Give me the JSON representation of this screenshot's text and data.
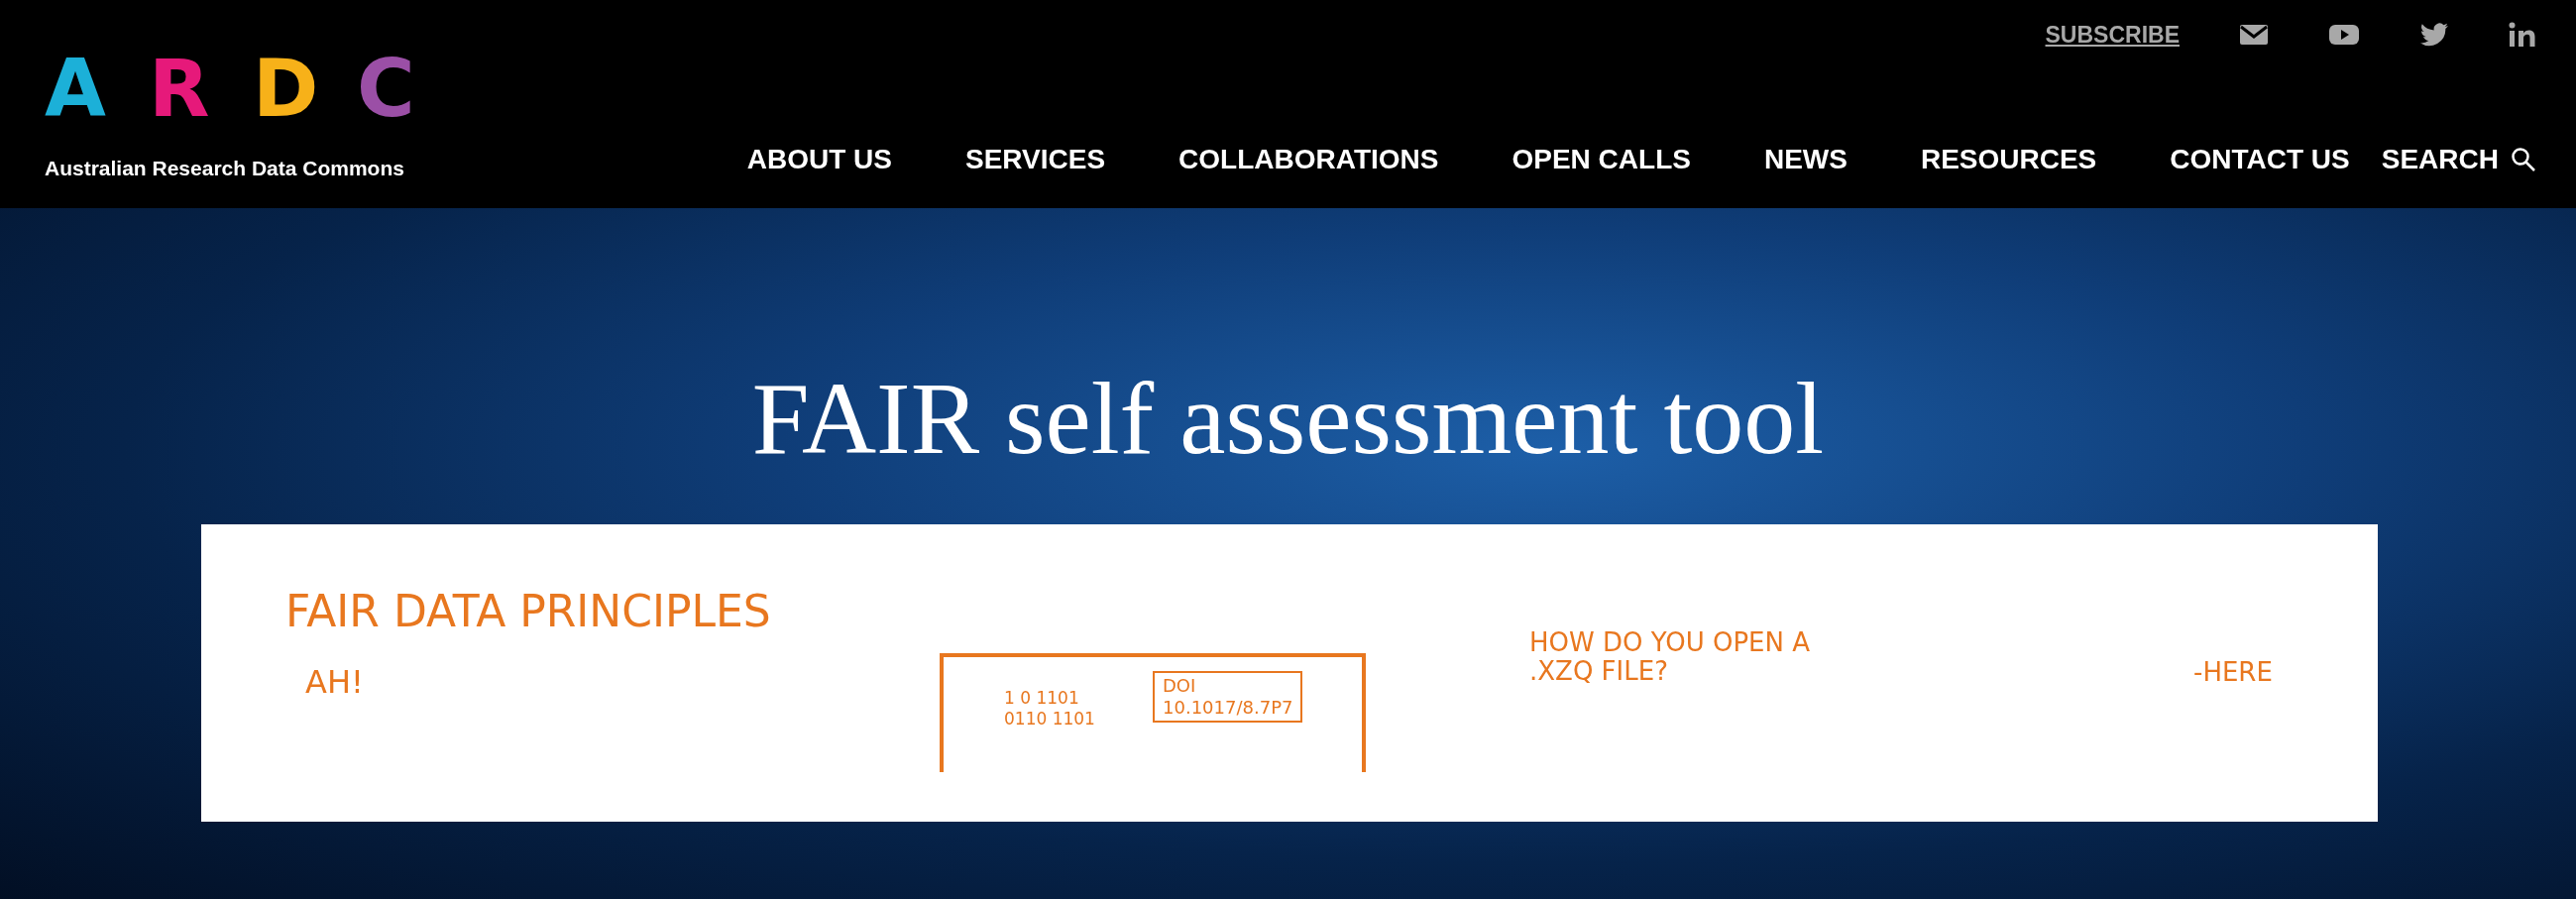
{
  "logo": {
    "letters": [
      {
        "text": "A",
        "color": "#1cb0d8"
      },
      {
        "text": "R",
        "color": "#e6197a"
      },
      {
        "text": "D",
        "color": "#f7b119"
      },
      {
        "text": "C",
        "color": "#9b4fa6"
      }
    ],
    "tagline": "Australian Research Data Commons"
  },
  "utility_bar": {
    "subscribe": "SUBSCRIBE",
    "social": [
      {
        "kind": "mail"
      },
      {
        "kind": "youtube"
      },
      {
        "kind": "twitter"
      },
      {
        "kind": "linkedin"
      }
    ]
  },
  "nav": {
    "items": [
      "ABOUT US",
      "SERVICES",
      "COLLABORATIONS",
      "OPEN CALLS",
      "NEWS",
      "RESOURCES",
      "CONTACT US"
    ],
    "search": "SEARCH"
  },
  "hero": {
    "title": "FAIR self assessment tool"
  },
  "illustration": {
    "heading": "FAIR DATA PRINCIPLES",
    "exclaim": "AH!",
    "screen_bits": [
      "1 0 1101",
      "0110 1101"
    ],
    "doi_label": "DOI",
    "doi": "10.1017/8.7P7",
    "question": "HOW DO YOU OPEN A .XZQ FILE?",
    "pointer": "-HERE"
  }
}
